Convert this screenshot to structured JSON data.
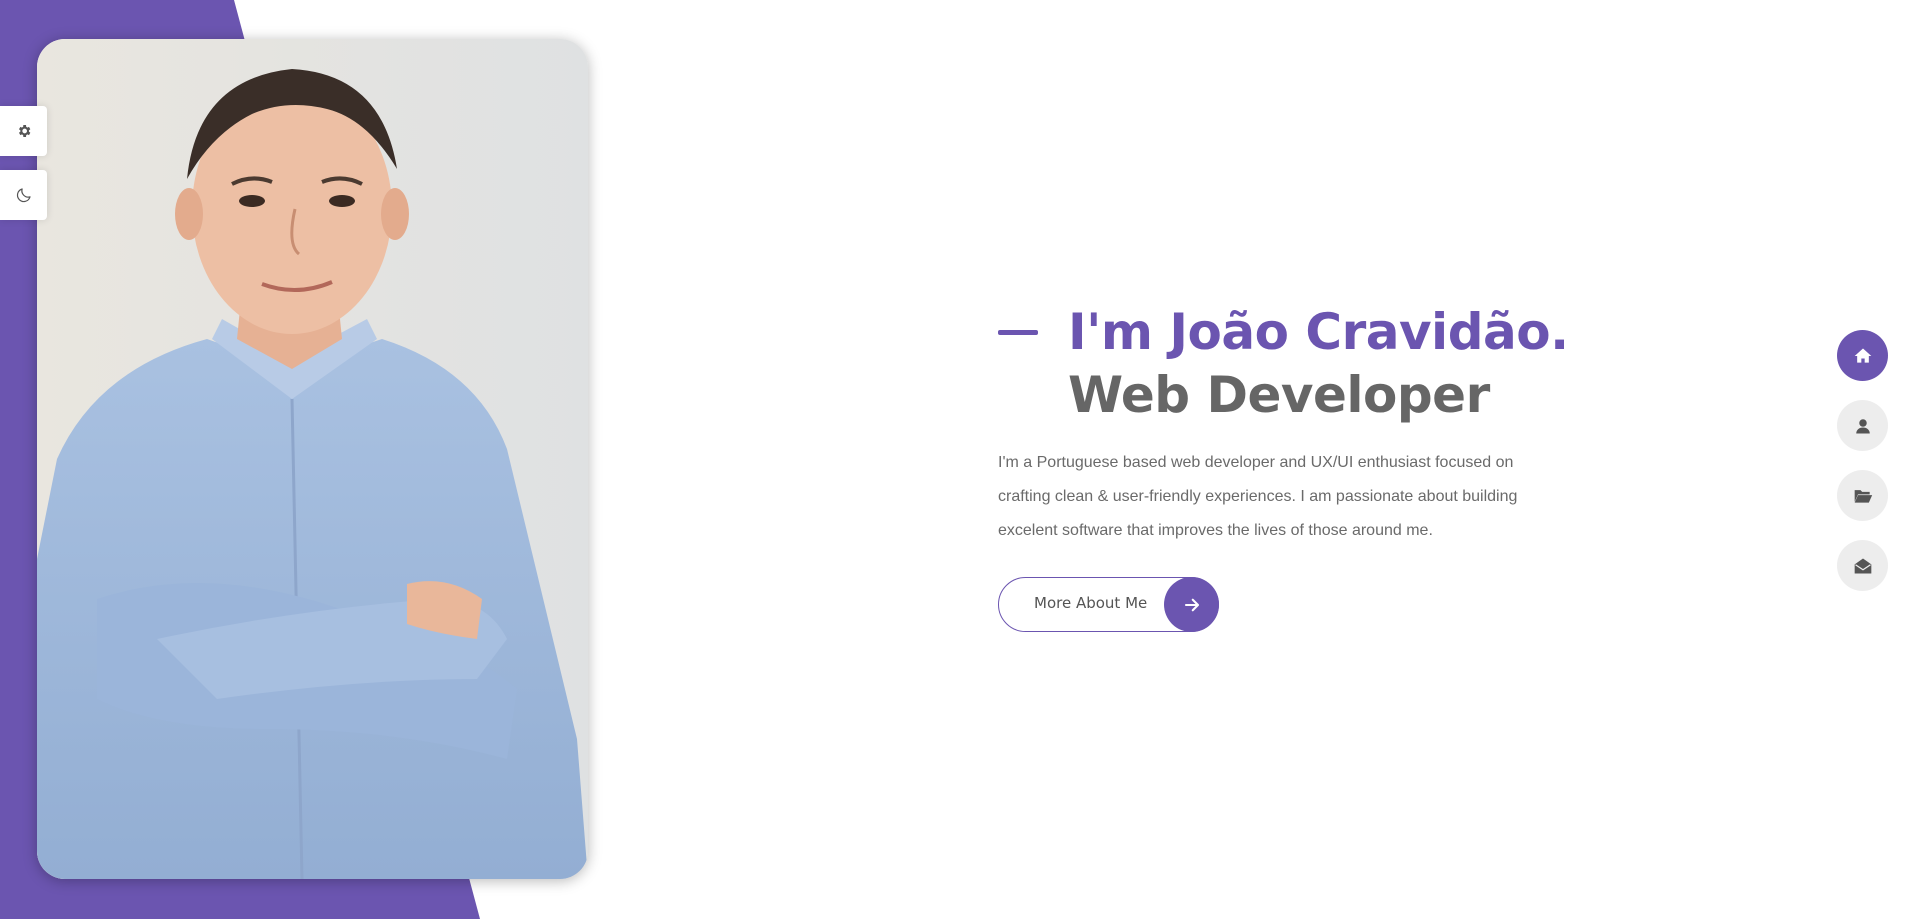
{
  "colors": {
    "accent": "#6b55b0",
    "heading_dark": "#666666",
    "text": "#6a6a6a",
    "nav_idle": "#ededed",
    "background": "#ffffff"
  },
  "sidebar_tools": [
    {
      "icon": "gear-icon"
    },
    {
      "icon": "moon-icon"
    }
  ],
  "hero": {
    "title_line1": "I'm João Cravidão.",
    "title_line2": "Web Developer",
    "description": "I'm a Portuguese based web developer and UX/UI enthusiast focused on crafting clean & user-friendly experiences. I am passionate about building excelent software that improves the lives of those around me.",
    "cta_label": "More About Me",
    "cta_icon": "arrow-right-icon"
  },
  "nav": [
    {
      "icon": "home-icon",
      "active": true
    },
    {
      "icon": "user-icon",
      "active": false
    },
    {
      "icon": "folder-open-icon",
      "active": false
    },
    {
      "icon": "envelope-open-icon",
      "active": false
    }
  ]
}
